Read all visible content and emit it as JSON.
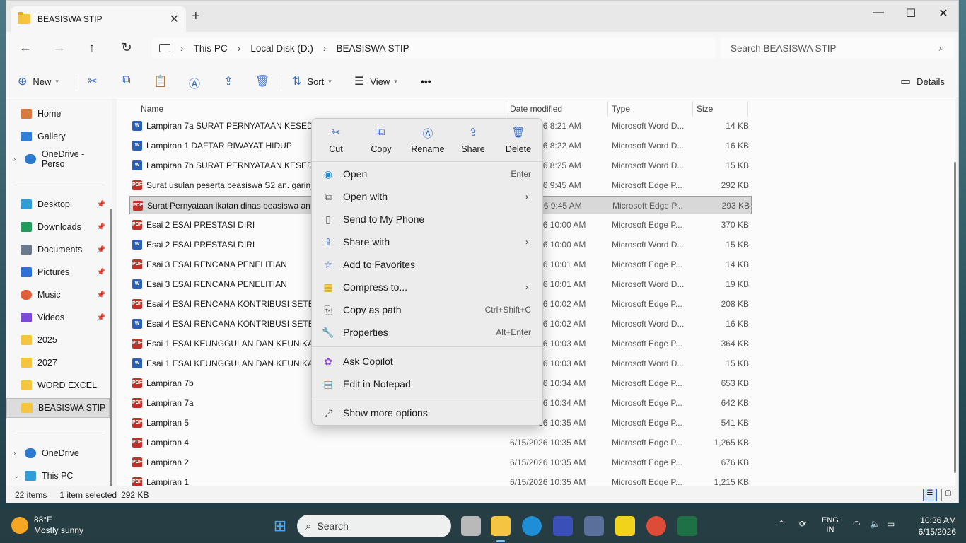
{
  "window": {
    "tab_title": "BEASISWA STIP",
    "new_tab": "+",
    "close_tab": "✕",
    "minimize": "—",
    "maximize": "☐",
    "close": "✕"
  },
  "address": {
    "crumbs": [
      "This PC",
      "Local Disk (D:)",
      "BEASISWA STIP"
    ],
    "search_placeholder": "Search BEASISWA STIP"
  },
  "commands": {
    "new": "New",
    "sort": "Sort",
    "view": "View",
    "more": "•••",
    "details": "Details"
  },
  "nav": {
    "home": "Home",
    "gallery": "Gallery",
    "onedrive_personal": "OneDrive - Perso",
    "desktop": "Desktop",
    "downloads": "Downloads",
    "documents": "Documents",
    "pictures": "Pictures",
    "music": "Music",
    "videos": "Videos",
    "f2025": "2025",
    "f2027": "2027",
    "word_excel": "WORD EXCEL",
    "beasiswa": "BEASISWA STIP",
    "onedrive": "OneDrive",
    "this_pc": "This PC"
  },
  "columns": {
    "name": "Name",
    "date": "Date modified",
    "type": "Type",
    "size": "Size"
  },
  "files": [
    {
      "name": "Lampiran 7a SURAT PERNYATAAN KESEDIAAN",
      "date": "6/15/2026 8:21 AM",
      "type": "Microsoft Word D...",
      "size": "14 KB",
      "kind": "word"
    },
    {
      "name": "Lampiran 1 DAFTAR RIWAYAT HIDUP",
      "date": "6/15/2026 8:22 AM",
      "type": "Microsoft Word D...",
      "size": "16 KB",
      "kind": "word"
    },
    {
      "name": "Lampiran 7b SURAT PERNYATAAN KESEDIAAN",
      "date": "6/15/2026 8:25 AM",
      "type": "Microsoft Word D...",
      "size": "15 KB",
      "kind": "word"
    },
    {
      "name": "Surat usulan peserta beasiswa S2 an. garin_sm",
      "date": "6/15/2026 9:45 AM",
      "type": "Microsoft Edge P...",
      "size": "292 KB",
      "kind": "pdf"
    },
    {
      "name": "Surat Pernyataan ikatan dinas beasiswa an. g",
      "date": "6/15/2026 9:45 AM",
      "type": "Microsoft Edge P...",
      "size": "293 KB",
      "kind": "pdf",
      "selected": true
    },
    {
      "name": "Esai 2 ESAI PRESTASI DIRI",
      "date": "6/15/2026 10:00 AM",
      "type": "Microsoft Edge P...",
      "size": "370 KB",
      "kind": "pdf"
    },
    {
      "name": "Esai 2 ESAI PRESTASI DIRI",
      "date": "6/15/2026 10:00 AM",
      "type": "Microsoft Word D...",
      "size": "15 KB",
      "kind": "word"
    },
    {
      "name": "Esai 3 ESAI RENCANA PENELITIAN",
      "date": "6/15/2026 10:01 AM",
      "type": "Microsoft Edge P...",
      "size": "14 KB",
      "kind": "pdf"
    },
    {
      "name": "Esai 3 ESAI RENCANA PENELITIAN",
      "date": "6/15/2026 10:01 AM",
      "type": "Microsoft Word D...",
      "size": "19 KB",
      "kind": "word"
    },
    {
      "name": "Esai 4 ESAI RENCANA KONTRIBUSI SETELAH",
      "date": "6/15/2026 10:02 AM",
      "type": "Microsoft Edge P...",
      "size": "208 KB",
      "kind": "pdf"
    },
    {
      "name": "Esai 4 ESAI RENCANA KONTRIBUSI SETELAH",
      "date": "6/15/2026 10:02 AM",
      "type": "Microsoft Word D...",
      "size": "16 KB",
      "kind": "word"
    },
    {
      "name": "Esai 1 ESAI KEUNGGULAN DAN KEUNIKAN D",
      "date": "6/15/2026 10:03 AM",
      "type": "Microsoft Edge P...",
      "size": "364 KB",
      "kind": "pdf"
    },
    {
      "name": "Esai 1 ESAI KEUNGGULAN DAN KEUNIKAN D",
      "date": "6/15/2026 10:03 AM",
      "type": "Microsoft Word D...",
      "size": "15 KB",
      "kind": "word"
    },
    {
      "name": "Lampiran 7b",
      "date": "6/15/2026 10:34 AM",
      "type": "Microsoft Edge P...",
      "size": "653 KB",
      "kind": "pdf"
    },
    {
      "name": "Lampiran 7a",
      "date": "6/15/2026 10:34 AM",
      "type": "Microsoft Edge P...",
      "size": "642 KB",
      "kind": "pdf"
    },
    {
      "name": "Lampiran 5",
      "date": "6/15/2026 10:35 AM",
      "type": "Microsoft Edge P...",
      "size": "541 KB",
      "kind": "pdf"
    },
    {
      "name": "Lampiran 4",
      "date": "6/15/2026 10:35 AM",
      "type": "Microsoft Edge P...",
      "size": "1,265 KB",
      "kind": "pdf"
    },
    {
      "name": "Lampiran 2",
      "date": "6/15/2026 10:35 AM",
      "type": "Microsoft Edge P...",
      "size": "676 KB",
      "kind": "pdf"
    },
    {
      "name": "Lampiran 1",
      "date": "6/15/2026 10:35 AM",
      "type": "Microsoft Edge P...",
      "size": "1,215 KB",
      "kind": "pdf"
    }
  ],
  "status": {
    "count": "22 items",
    "selected": "1 item selected",
    "size": "292 KB"
  },
  "context_menu": {
    "cut": "Cut",
    "copy": "Copy",
    "rename": "Rename",
    "share": "Share",
    "delete": "Delete",
    "open": "Open",
    "open_sc": "Enter",
    "open_with": "Open with",
    "send_to_phone": "Send to My Phone",
    "share_with": "Share with",
    "add_favorites": "Add to Favorites",
    "compress": "Compress to...",
    "copy_path": "Copy as path",
    "copy_path_sc": "Ctrl+Shift+C",
    "properties": "Properties",
    "properties_sc": "Alt+Enter",
    "ask_copilot": "Ask Copilot",
    "edit_notepad": "Edit in Notepad",
    "show_more": "Show more options"
  },
  "taskbar": {
    "temp": "88°F",
    "weather": "Mostly sunny",
    "search": "Search",
    "lang1": "ENG",
    "lang2": "IN",
    "time": "10:36 AM",
    "date": "6/15/2026"
  }
}
